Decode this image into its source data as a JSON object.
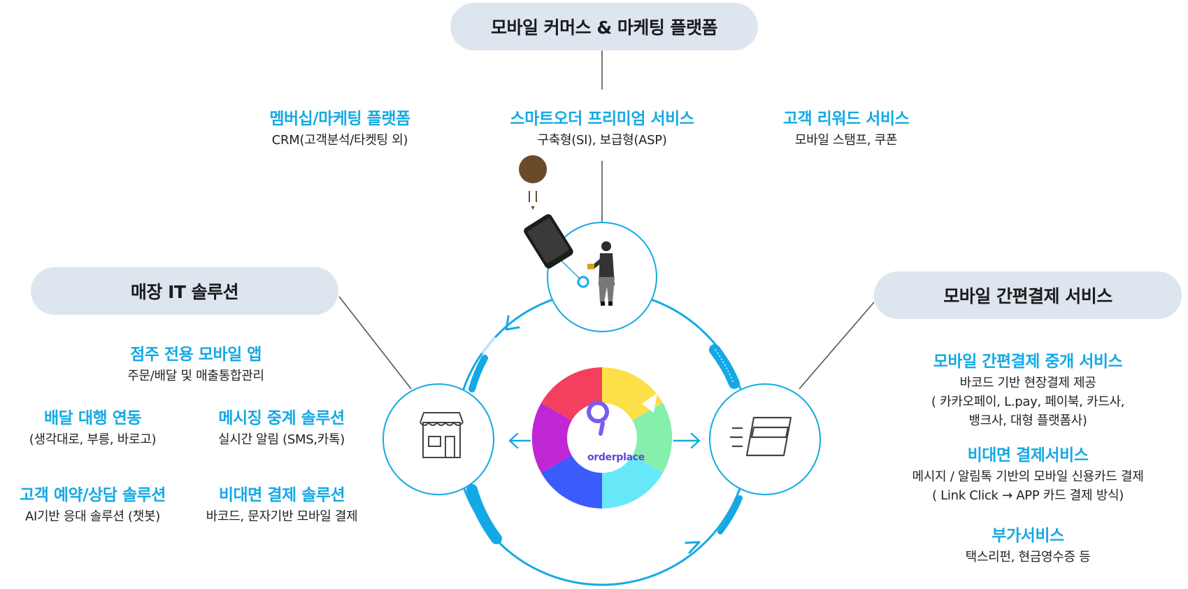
{
  "headers": {
    "top": "모바일 커머스 & 마케팅 플랫폼",
    "left": "매장 IT 솔루션",
    "right": "모바일 간편결제 서비스"
  },
  "top_services": [
    {
      "title": "멤버십/마케팅 플랫폼",
      "desc": "CRM(고객분석/타켓팅 외)"
    },
    {
      "title": "스마트오더 프리미엄 서비스",
      "desc": "구축형(SI),  보급형(ASP)"
    },
    {
      "title": "고객 리워드 서비스",
      "desc": "모바일 스탬프, 쿠폰"
    }
  ],
  "left_services": [
    {
      "title": "점주 전용 모바일 앱",
      "desc": "주문/배달 및 매출통합관리"
    },
    {
      "title": "배달 대행  연동",
      "desc": "(생각대로, 부릉, 바로고)"
    },
    {
      "title": "메시징 중계 솔루션",
      "desc": "실시간 알림 (SMS,카톡)"
    },
    {
      "title": "고객 예약/상담 솔루션",
      "desc": "AI기반 응대 솔루션 (챗봇)"
    },
    {
      "title": "비대면 결제 솔루션",
      "desc": "바코드, 문자기반  모바일 결제"
    }
  ],
  "right_services": [
    {
      "title": "모바일 간편결제 중개 서비스",
      "lines": [
        "바코드 기반 현장결제 제공",
        "( 카카오페이, L.pay, 페이북, 카드사,",
        "뱅크사, 대형 플랫폼사)"
      ]
    },
    {
      "title": "비대면 결제서비스",
      "lines": [
        "메시지 / 알림톡 기반의 모바일 신용카드 결제",
        "( Link Click → APP 카드 결제 방식)"
      ]
    },
    {
      "title": "부가서비스",
      "lines": [
        "택스리펀, 현금영수증 등"
      ]
    }
  ],
  "logo": {
    "text": "orderplace"
  },
  "icons": [
    "pin-icon",
    "smartphone-icon",
    "shopper-person-icon",
    "store-icon",
    "payment-card-icon"
  ],
  "colors": {
    "accent": "#14a9e5",
    "pill": "#dde5ef",
    "line": "#555555",
    "logo_purple": "#7a5cf0"
  }
}
